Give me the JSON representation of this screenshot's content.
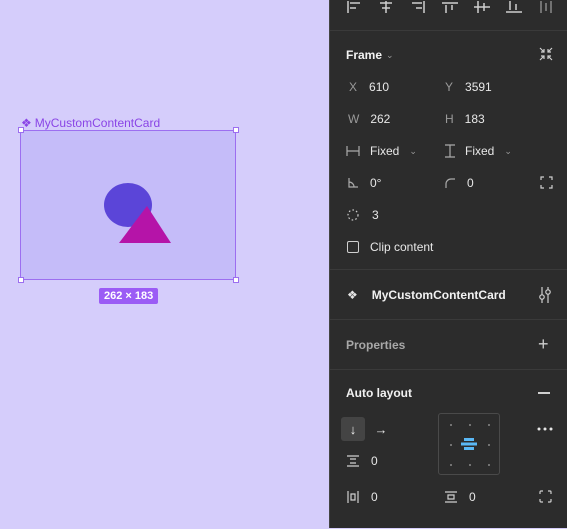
{
  "canvas": {
    "component_name": "MyCustomContentCard",
    "size_badge": "262 × 183"
  },
  "panel": {
    "frame": {
      "title": "Frame",
      "x_label": "X",
      "x_value": "610",
      "y_label": "Y",
      "y_value": "3591",
      "w_label": "W",
      "w_value": "262",
      "h_label": "H",
      "h_value": "183",
      "width_mode": "Fixed",
      "height_mode": "Fixed",
      "rotation": "0°",
      "corner_radius": "0",
      "count_value": "3",
      "clip_label": "Clip content"
    },
    "component": {
      "name": "MyCustomContentCard"
    },
    "properties": {
      "title": "Properties"
    },
    "auto_layout": {
      "title": "Auto layout",
      "gap": "0",
      "padding_h": "0",
      "padding_v": "0"
    }
  },
  "colors": {
    "accent": "#9b5cf5",
    "circle": "#5b45d8",
    "triangle": "#b514a8",
    "panel_bg": "#2c2c2c",
    "canvas_bg": "#d5cdfb"
  }
}
